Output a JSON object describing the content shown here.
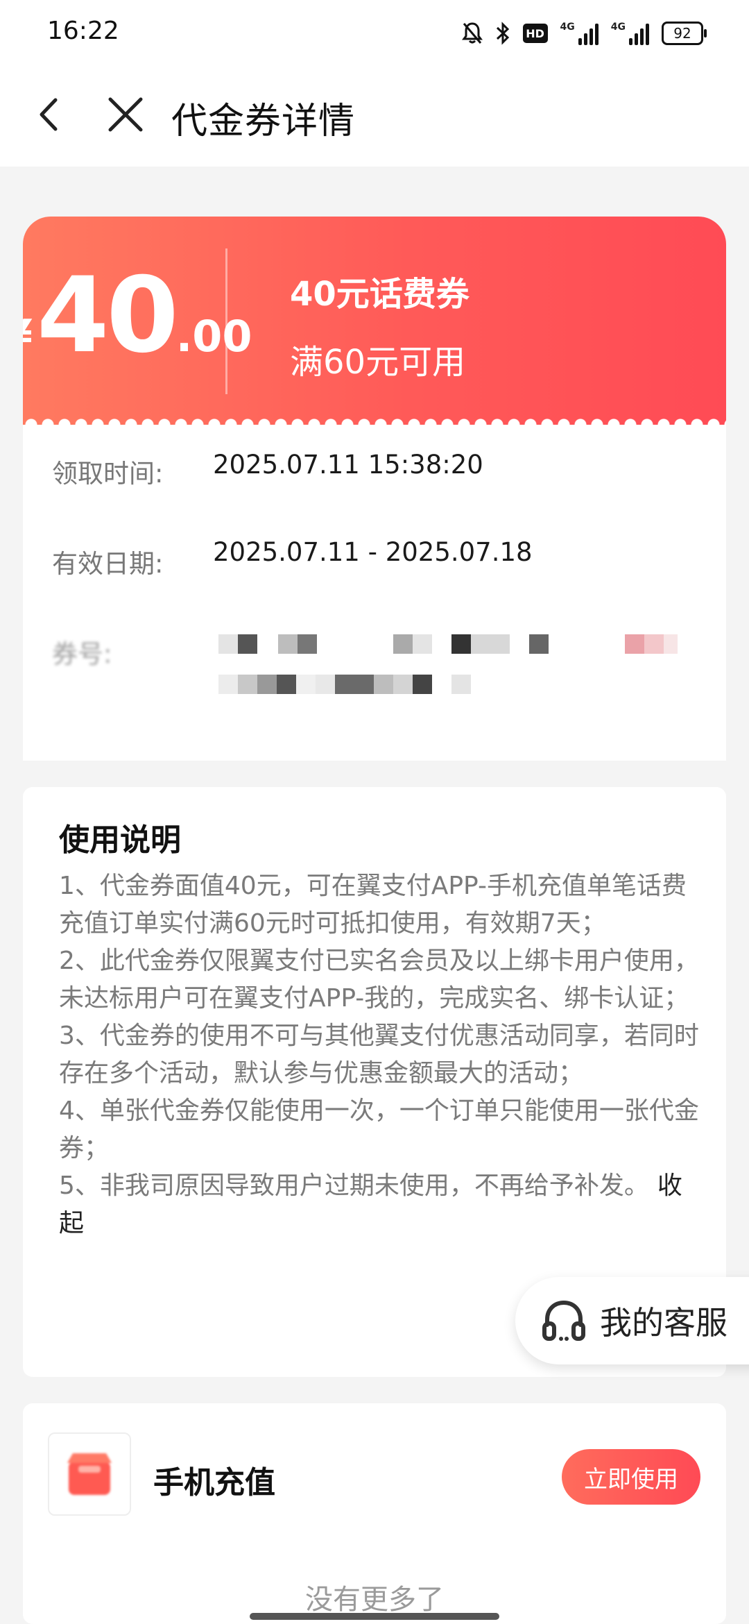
{
  "status_bar": {
    "time": "16:22",
    "hd": "HD",
    "network_1": "4G",
    "network_2": "4G",
    "battery": "92"
  },
  "header": {
    "title": "代金券详情"
  },
  "coupon": {
    "currency": "¥",
    "amount_int": "40",
    "amount_dec": ".00",
    "name": "40元话费券",
    "condition": "满60元可用",
    "claim_time_label": "领取时间:",
    "claim_time_value": "2025.07.11 15:38:20",
    "valid_label": "有效日期:",
    "valid_value": "2025.07.11 - 2025.07.18",
    "code_label": "券号:",
    "accent_color": "#ff5a58"
  },
  "usage": {
    "title": "使用说明",
    "items": [
      "1、代金券面值40元，可在翼支付APP-手机充值单笔话费充值订单实付满60元时可抵扣使用，有效期7天；",
      "2、此代金券仅限翼支付已实名会员及以上绑卡用户使用，未达标用户可在翼支付APP-我的，完成实名、绑卡认证；",
      "3、代金券的使用不可与其他翼支付优惠活动同享，若同时存在多个活动，默认参与优惠金额最大的活动；",
      "4、单张代金券仅能使用一次，一个订单只能使用一张代金券；",
      "5、非我司原因导致用户过期未使用，不再给予补发。"
    ],
    "collapse": "收起"
  },
  "customer_service": {
    "label": "我的客服"
  },
  "product": {
    "name": "手机充值",
    "button": "立即使用"
  },
  "footer": {
    "no_more": "没有更多了"
  }
}
